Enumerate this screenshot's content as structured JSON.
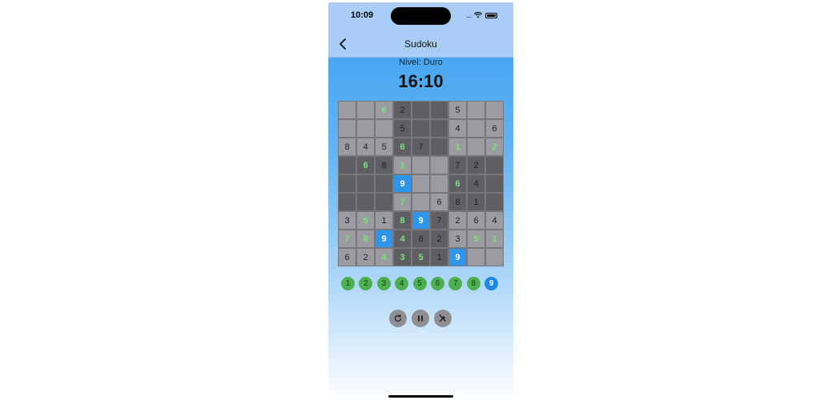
{
  "status": {
    "time": "10:09",
    "signal": "...."
  },
  "nav": {
    "title": "Sudoku"
  },
  "game": {
    "level_label": "Nivel: Duro",
    "timer": "16:10"
  },
  "board": [
    [
      {
        "v": "",
        "t": "light"
      },
      {
        "v": "",
        "t": "light"
      },
      {
        "v": "6",
        "t": "light",
        "g": true
      },
      {
        "v": "2",
        "t": "dark"
      },
      {
        "v": "",
        "t": "dark"
      },
      {
        "v": "",
        "t": "dark"
      },
      {
        "v": "5",
        "t": "light"
      },
      {
        "v": "",
        "t": "light"
      },
      {
        "v": "",
        "t": "light"
      }
    ],
    [
      {
        "v": "",
        "t": "light"
      },
      {
        "v": "",
        "t": "light"
      },
      {
        "v": "",
        "t": "light"
      },
      {
        "v": "5",
        "t": "dark"
      },
      {
        "v": "",
        "t": "dark"
      },
      {
        "v": "",
        "t": "dark"
      },
      {
        "v": "4",
        "t": "light"
      },
      {
        "v": "",
        "t": "light"
      },
      {
        "v": "6",
        "t": "light"
      }
    ],
    [
      {
        "v": "8",
        "t": "light"
      },
      {
        "v": "4",
        "t": "light"
      },
      {
        "v": "5",
        "t": "light"
      },
      {
        "v": "6",
        "t": "dark",
        "g": true
      },
      {
        "v": "7",
        "t": "dark"
      },
      {
        "v": "",
        "t": "dark"
      },
      {
        "v": "1",
        "t": "light",
        "g": true
      },
      {
        "v": "",
        "t": "light"
      },
      {
        "v": "2",
        "t": "light",
        "g": true
      }
    ],
    [
      {
        "v": "",
        "t": "dark"
      },
      {
        "v": "6",
        "t": "dark",
        "g": true
      },
      {
        "v": "8",
        "t": "dark"
      },
      {
        "v": "1",
        "t": "light",
        "g": true
      },
      {
        "v": "",
        "t": "light"
      },
      {
        "v": "",
        "t": "light"
      },
      {
        "v": "7",
        "t": "dark"
      },
      {
        "v": "2",
        "t": "dark"
      },
      {
        "v": "",
        "t": "dark"
      }
    ],
    [
      {
        "v": "",
        "t": "dark"
      },
      {
        "v": "",
        "t": "dark"
      },
      {
        "v": "",
        "t": "dark"
      },
      {
        "v": "9",
        "t": "sel"
      },
      {
        "v": "",
        "t": "light"
      },
      {
        "v": "",
        "t": "light"
      },
      {
        "v": "6",
        "t": "dark",
        "g": true
      },
      {
        "v": "4",
        "t": "dark"
      },
      {
        "v": "",
        "t": "dark"
      }
    ],
    [
      {
        "v": "",
        "t": "dark"
      },
      {
        "v": "",
        "t": "dark"
      },
      {
        "v": "",
        "t": "dark"
      },
      {
        "v": "7",
        "t": "light",
        "g": true
      },
      {
        "v": "",
        "t": "light"
      },
      {
        "v": "6",
        "t": "light"
      },
      {
        "v": "8",
        "t": "dark"
      },
      {
        "v": "1",
        "t": "dark"
      },
      {
        "v": "",
        "t": "dark"
      }
    ],
    [
      {
        "v": "3",
        "t": "light"
      },
      {
        "v": "5",
        "t": "light",
        "g": true
      },
      {
        "v": "1",
        "t": "light"
      },
      {
        "v": "8",
        "t": "dark",
        "g": true
      },
      {
        "v": "9",
        "t": "sel"
      },
      {
        "v": "7",
        "t": "dark"
      },
      {
        "v": "2",
        "t": "light"
      },
      {
        "v": "6",
        "t": "light"
      },
      {
        "v": "4",
        "t": "light"
      }
    ],
    [
      {
        "v": "7",
        "t": "light",
        "g": true
      },
      {
        "v": "8",
        "t": "light",
        "g": true
      },
      {
        "v": "9",
        "t": "sel"
      },
      {
        "v": "4",
        "t": "dark",
        "g": true
      },
      {
        "v": "6",
        "t": "dark"
      },
      {
        "v": "2",
        "t": "dark"
      },
      {
        "v": "3",
        "t": "light"
      },
      {
        "v": "5",
        "t": "light",
        "g": true
      },
      {
        "v": "1",
        "t": "light",
        "g": true
      }
    ],
    [
      {
        "v": "6",
        "t": "light"
      },
      {
        "v": "2",
        "t": "light"
      },
      {
        "v": "4",
        "t": "light",
        "g": true
      },
      {
        "v": "3",
        "t": "dark",
        "g": true
      },
      {
        "v": "5",
        "t": "dark",
        "g": true
      },
      {
        "v": "1",
        "t": "dark"
      },
      {
        "v": "9",
        "t": "sel"
      },
      {
        "v": "",
        "t": "light"
      },
      {
        "v": "",
        "t": "light"
      }
    ]
  ],
  "numpad": [
    "1",
    "2",
    "3",
    "4",
    "5",
    "6",
    "7",
    "8",
    "9"
  ],
  "numpad_selected": "9",
  "colors": {
    "accent": "#2e96ea",
    "numpad_green": "#4caf50",
    "given_green": "#7ae27a",
    "cell_light": "#9b9ba2",
    "cell_dark": "#5f5f63"
  },
  "controls": [
    {
      "icon": "restart-icon"
    },
    {
      "icon": "pause-icon"
    },
    {
      "icon": "hint-tools-icon"
    }
  ]
}
